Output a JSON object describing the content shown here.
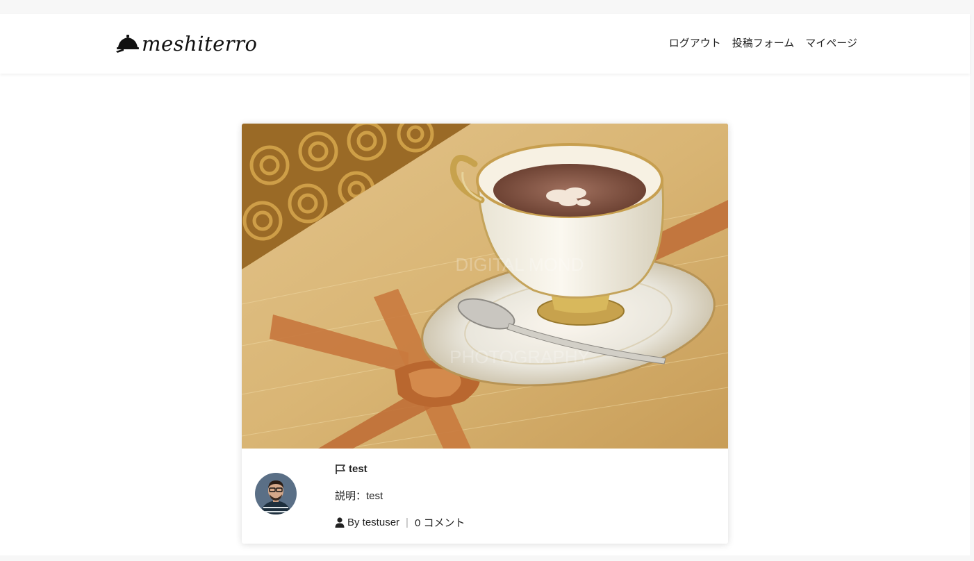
{
  "brand": {
    "name": "meshiterro",
    "icon": "cloche-icon"
  },
  "nav": {
    "logout": "ログアウト",
    "post_form": "投稿フォーム",
    "mypage": "マイページ"
  },
  "post": {
    "title": "test",
    "description": "説明：test",
    "author": "By testuser",
    "separator": "|",
    "comments": "0 コメント",
    "image_subject": "hot-chocolate-cup-photo",
    "watermark_lines": [
      "DIGITAL MOND",
      "PHOTOGRAPHY"
    ]
  },
  "colors": {
    "page_bg": "#f7f7f7",
    "card_bg": "#ffffff",
    "text": "#222222"
  }
}
